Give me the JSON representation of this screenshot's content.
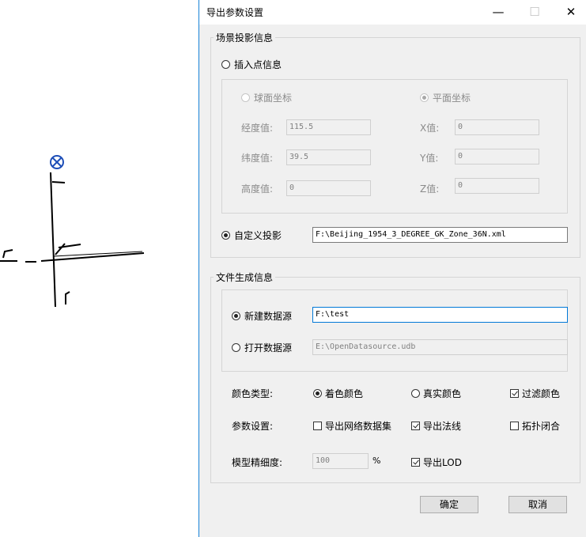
{
  "dialog": {
    "title": "导出参数设置",
    "window_controls": {
      "minimize": "—",
      "maximize": "☐",
      "close": "✕"
    },
    "scene_group": {
      "label": "场景投影信息",
      "insert_point": {
        "label": "插入点信息",
        "selected": false
      },
      "spherical": {
        "label": "球面坐标",
        "selected": false
      },
      "planar": {
        "label": "平面坐标",
        "selected": true
      },
      "longitude": {
        "label": "经度值:",
        "value": "115.5"
      },
      "latitude": {
        "label": "纬度值:",
        "value": "39.5"
      },
      "altitude": {
        "label": "高度值:",
        "value": "0"
      },
      "x": {
        "label": "X值:",
        "value": "0"
      },
      "y": {
        "label": "Y值:",
        "value": "0"
      },
      "z": {
        "label": "Z值:",
        "value": "0"
      },
      "custom_projection": {
        "label": "自定义投影",
        "selected": true,
        "value": "F:\\Beijing_1954_3_DEGREE_GK_Zone_36N.xml"
      }
    },
    "file_group": {
      "label": "文件生成信息",
      "new_datasource": {
        "label": "新建数据源",
        "selected": true,
        "value": "F:\\test"
      },
      "open_datasource": {
        "label": "打开数据源",
        "selected": false,
        "value": "E:\\OpenDatasource.udb"
      },
      "color_type": {
        "label": "颜色类型:",
        "options": [
          "着色颜色",
          "真实颜色"
        ],
        "selected": "着色颜色"
      },
      "filter_color": {
        "label": "过滤颜色",
        "checked": true
      },
      "params": {
        "label": "参数设置:"
      },
      "export_network": {
        "label": "导出网络数据集",
        "checked": false
      },
      "export_normals": {
        "label": "导出法线",
        "checked": true
      },
      "topology_close": {
        "label": "拓扑闭合",
        "checked": false
      },
      "model_precision": {
        "label": "模型精细度:",
        "value": "100",
        "unit": "%"
      },
      "export_lod": {
        "label": "导出LOD",
        "checked": true
      }
    },
    "buttons": {
      "ok": "确定",
      "cancel": "取消"
    }
  },
  "colors": {
    "accent": "#0078d7",
    "window_border": "#1883d7",
    "marker": "#1f4fb8"
  }
}
